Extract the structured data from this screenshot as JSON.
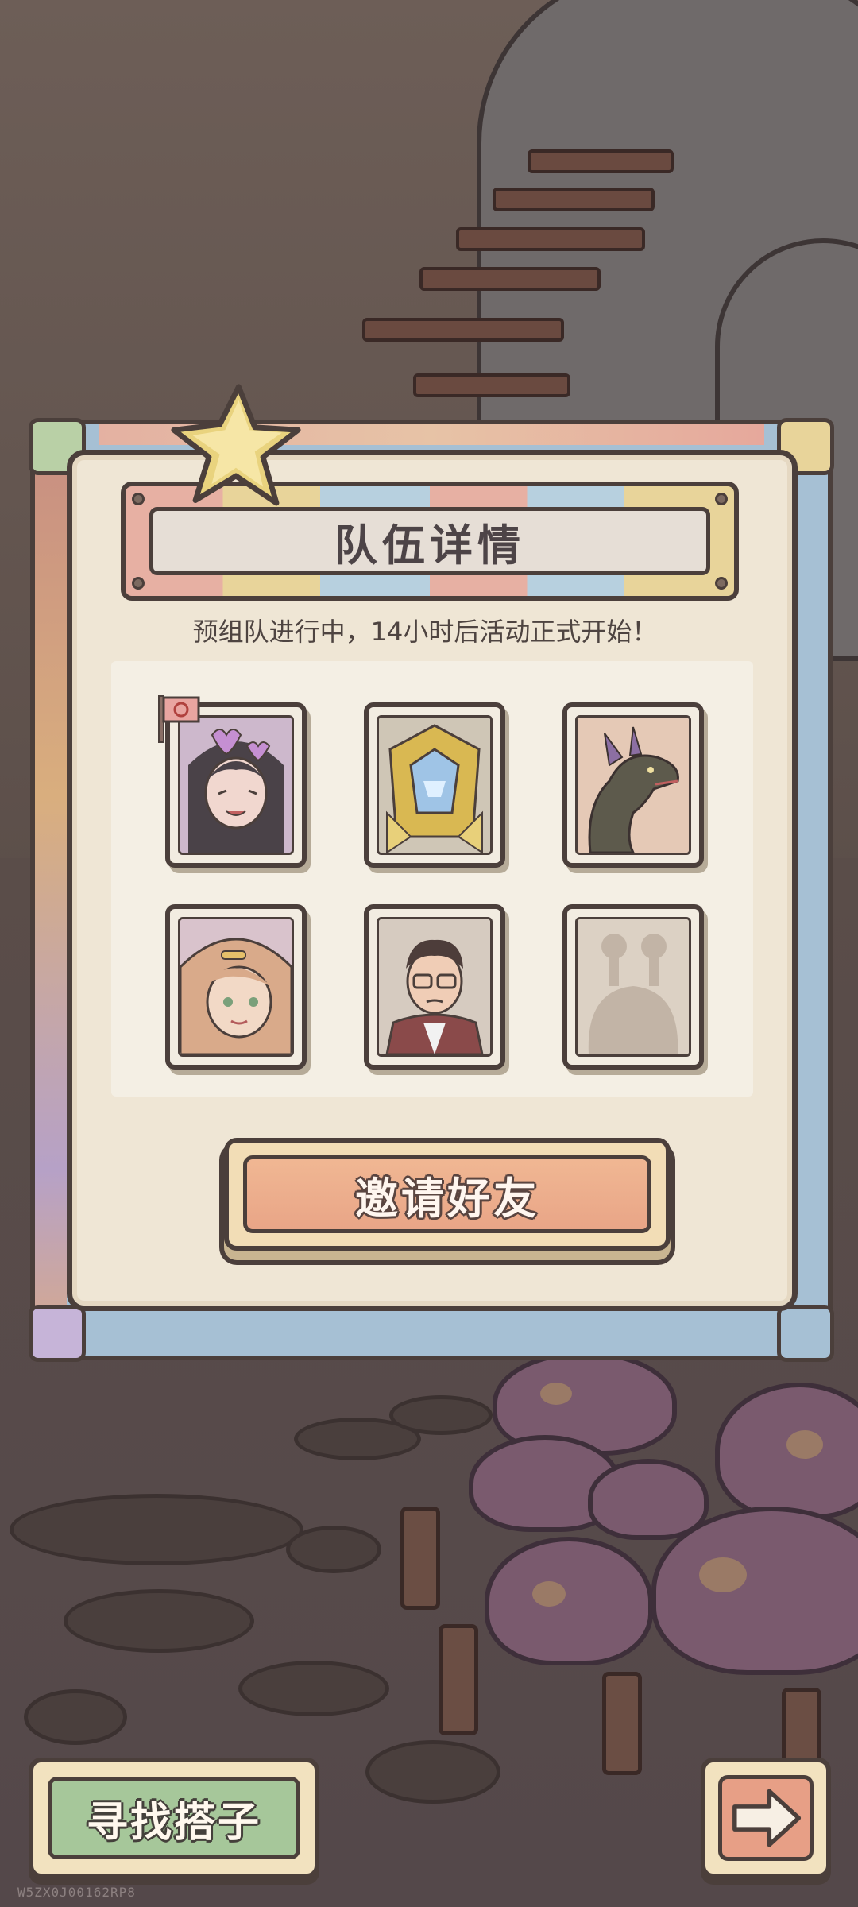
{
  "dialog": {
    "title": "队伍详情",
    "subtitle": "预组队进行中，14小时后活动正式开始！",
    "invite_button_label": "邀请好友"
  },
  "members": [
    {
      "portrait": "girl-with-hearts",
      "leader": true,
      "empty": false
    },
    {
      "portrait": "golden-armored-knight",
      "leader": false,
      "empty": false
    },
    {
      "portrait": "dragon",
      "leader": false,
      "empty": false
    },
    {
      "portrait": "girl-with-hair-clip",
      "leader": false,
      "empty": false
    },
    {
      "portrait": "man-with-glasses",
      "leader": false,
      "empty": false
    },
    {
      "portrait": "empty-silhouette",
      "leader": false,
      "empty": true
    }
  ],
  "bottom_bar": {
    "find_partner_label": "寻找搭子",
    "next_arrow_icon": "arrow-right-icon"
  },
  "footer": {
    "device_id": "W5ZX0J00162RP8"
  },
  "colors": {
    "panel": "#efe6d5",
    "invite_button": "#e9a587",
    "find_button": "#a6c79a",
    "outline": "#4b3f3b"
  }
}
